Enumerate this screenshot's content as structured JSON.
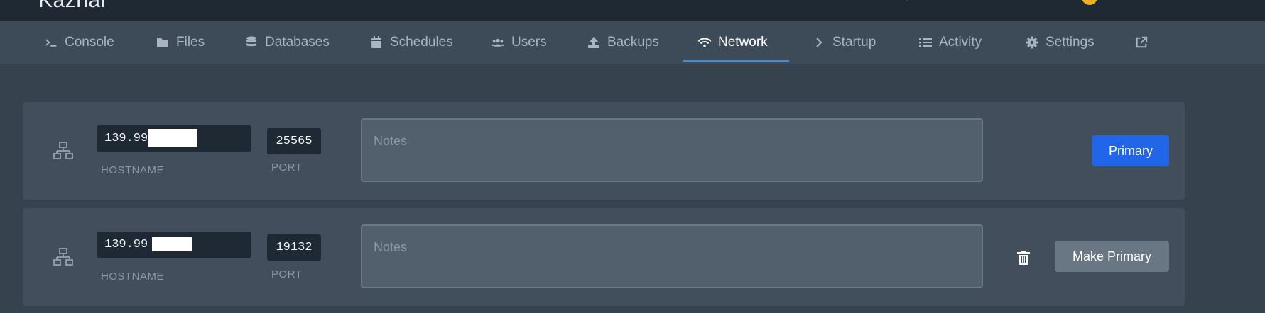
{
  "header": {
    "brand": "Kaznar"
  },
  "nav": {
    "tabs": [
      {
        "label": "Console",
        "icon": "terminal-icon"
      },
      {
        "label": "Files",
        "icon": "folder-icon"
      },
      {
        "label": "Databases",
        "icon": "database-icon"
      },
      {
        "label": "Schedules",
        "icon": "calendar-icon"
      },
      {
        "label": "Users",
        "icon": "users-icon"
      },
      {
        "label": "Backups",
        "icon": "upload-icon"
      },
      {
        "label": "Network",
        "icon": "wifi-icon",
        "active": true
      },
      {
        "label": "Startup",
        "icon": "chevron-right-icon"
      },
      {
        "label": "Activity",
        "icon": "list-icon"
      },
      {
        "label": "Settings",
        "icon": "gear-icon"
      },
      {
        "label": "",
        "icon": "external-link-icon"
      }
    ]
  },
  "allocations": [
    {
      "hostname": "139.99",
      "hostname_label": "HOSTNAME",
      "port": "25565",
      "port_label": "PORT",
      "notes_placeholder": "Notes",
      "action_label": "Primary",
      "is_primary": true
    },
    {
      "hostname": "139.99",
      "hostname_label": "HOSTNAME",
      "port": "19132",
      "port_label": "PORT",
      "notes_placeholder": "Notes",
      "action_label": "Make Primary",
      "is_primary": false
    }
  ],
  "colors": {
    "accent": "#2166e8",
    "tab_underline": "#3b8fd9",
    "background": "#37424f",
    "card": "#424e5b"
  }
}
